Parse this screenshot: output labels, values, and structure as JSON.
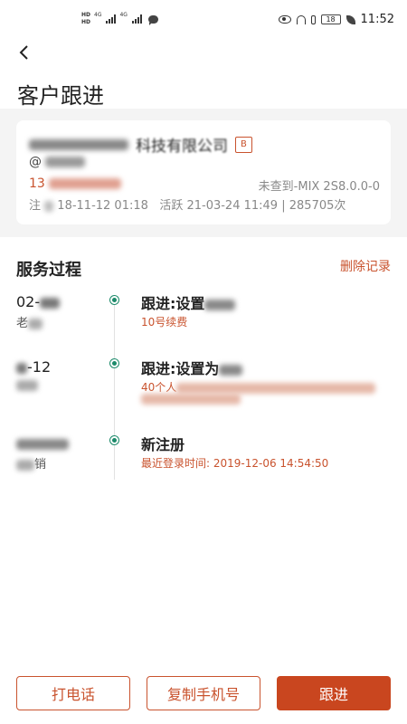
{
  "status_bar": {
    "hd1": "HD",
    "hd2": "HD",
    "net1": "4G",
    "net2": "4G",
    "battery": "18",
    "time": "11:52"
  },
  "header": {
    "back_icon": "chevron-left-icon",
    "title": "客户跟进"
  },
  "customer": {
    "company": "科技有限公司",
    "badge": "B",
    "wechat": "@",
    "phone": "13",
    "device": "未查到-MIX 2S8.0.0-0",
    "register_prefix": "注",
    "register_date": "18-11-12 01:18",
    "active_label": "活跃",
    "active_date": "21-03-24 11:49",
    "separator": "|",
    "visit_count": "285705次"
  },
  "service": {
    "title": "服务过程",
    "delete_label": "删除记录",
    "items": [
      {
        "date": "02-",
        "person": "老",
        "title": "跟进:设置",
        "desc": "10号续费"
      },
      {
        "date": "-12",
        "person": "",
        "title": "跟进:设置为",
        "desc": "40个人"
      },
      {
        "date": "",
        "person": "销",
        "title": "新注册",
        "desc": "最近登录时间:  2019-12-06 14:54:50"
      }
    ]
  },
  "actions": {
    "call": "打电话",
    "copy_phone": "复制手机号",
    "follow": "跟进"
  },
  "colors": {
    "accent": "#c9461f",
    "timeline_dot": "#1c8a6a"
  }
}
